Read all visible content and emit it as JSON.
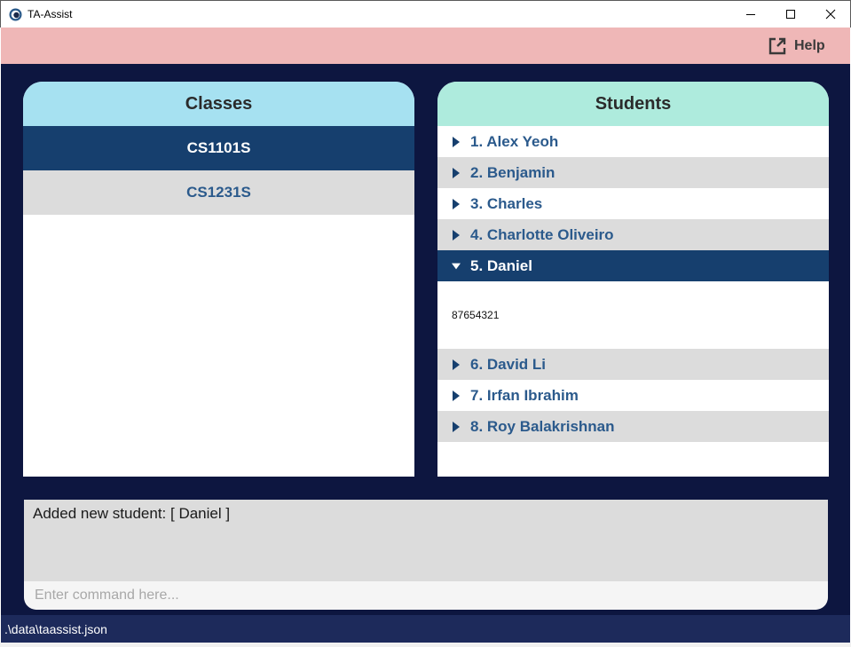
{
  "window": {
    "title": "TA-Assist",
    "app_icon": "ta-assist-logo-icon",
    "controls": [
      "minimize-icon",
      "maximize-icon",
      "close-icon"
    ]
  },
  "menubar": {
    "help_label": "Help",
    "help_icon": "external-link-icon"
  },
  "classes": {
    "header": "Classes",
    "items": [
      {
        "label": "CS1101S",
        "selected": true
      },
      {
        "label": "CS1231S",
        "selected": false
      }
    ]
  },
  "students": {
    "header": "Students",
    "items": [
      {
        "label": "1. Alex Yeoh",
        "expanded": false
      },
      {
        "label": "2. Benjamin",
        "expanded": false
      },
      {
        "label": "3. Charles",
        "expanded": false
      },
      {
        "label": "4. Charlotte Oliveiro",
        "expanded": false
      },
      {
        "label": "5. Daniel",
        "expanded": true,
        "detail": "87654321"
      },
      {
        "label": "6. David Li",
        "expanded": false
      },
      {
        "label": "7. Irfan Ibrahim",
        "expanded": false
      },
      {
        "label": "8. Roy Balakrishnan",
        "expanded": false
      }
    ]
  },
  "result": {
    "message": "Added new student: [ Daniel ]"
  },
  "command": {
    "value": "",
    "placeholder": "Enter command here..."
  },
  "statusbar": {
    "file_path": ".\\data\\taassist.json"
  },
  "colors": {
    "background": "#0d1640",
    "menubar": "#efb7b7",
    "classes_header": "#a6e1f1",
    "students_header": "#aeebdd",
    "selected": "#163f6e",
    "item_text": "#2b5a8c",
    "alt_row": "#dcdcdc",
    "statusbar": "#1d2a5b"
  }
}
